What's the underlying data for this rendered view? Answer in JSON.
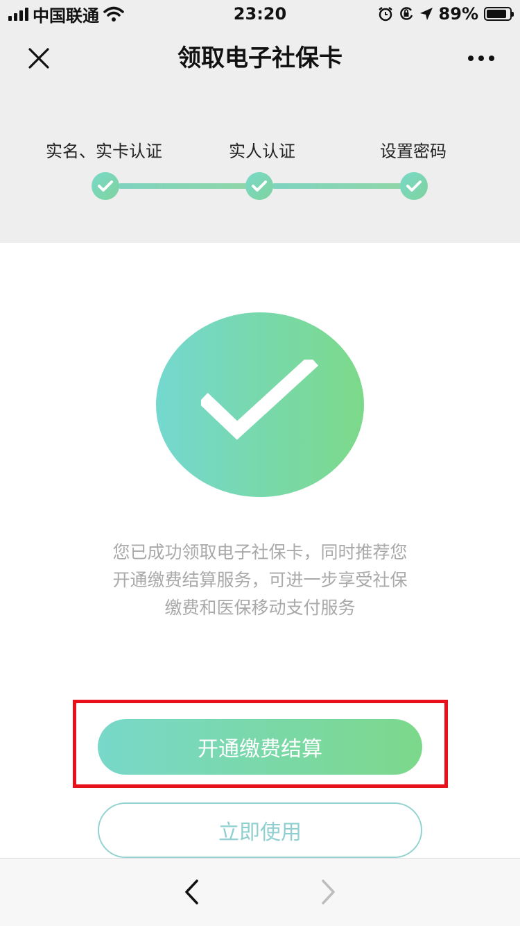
{
  "status_bar": {
    "carrier": "中国联通",
    "time": "23:20",
    "battery_percent_text": "89%",
    "battery_level": 0.89,
    "icons": [
      "signal-icon",
      "wifi-icon",
      "alarm-icon",
      "orientation-lock-icon",
      "location-icon",
      "battery-icon"
    ]
  },
  "nav": {
    "title": "领取电子社保卡",
    "close_icon": "close-icon",
    "more_icon": "more-icon"
  },
  "steps": [
    {
      "label": "实名、实卡认证",
      "status": "done"
    },
    {
      "label": "实人认证",
      "status": "done"
    },
    {
      "label": "设置密码",
      "status": "done"
    }
  ],
  "success": {
    "icon": "success-check-icon",
    "message_lines": [
      "您已成功领取电子社保卡，同时推荐您",
      "开通缴费结算服务，可进一步享受社保",
      "缴费和医保移动支付服务"
    ]
  },
  "actions": {
    "primary_label": "开通缴费结算",
    "secondary_label": "立即使用"
  },
  "colors": {
    "accent_start": "#78d8ca",
    "accent_end": "#7cd88a",
    "highlight": "#e8101b",
    "message_text": "#a9a9a9"
  },
  "toolbar": {
    "back_icon": "back-arrow-icon",
    "forward_icon": "forward-arrow-icon"
  }
}
